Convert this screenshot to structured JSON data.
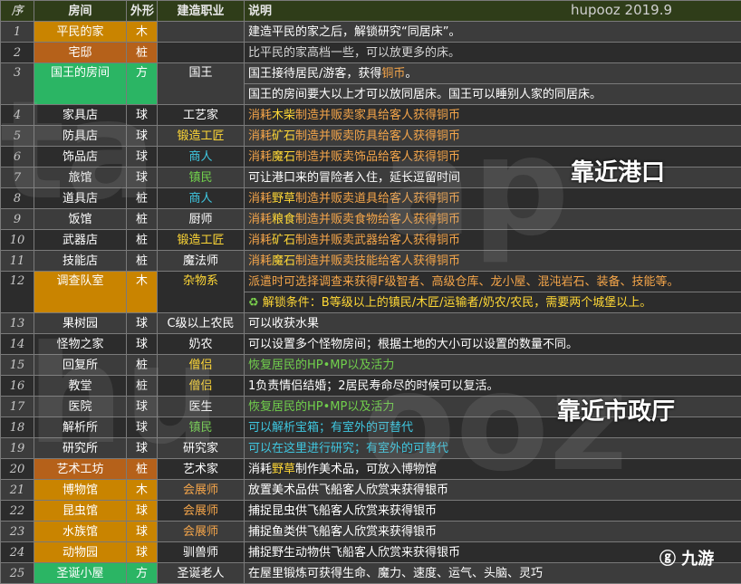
{
  "watermark": "hupooz 2019.9",
  "headers": {
    "idx": "序",
    "name": "房间",
    "shape": "外形",
    "job": "建造职业",
    "desc": "说明"
  },
  "annotations": {
    "port": "靠近港口",
    "cityhall": "靠近市政厅"
  },
  "logo": "九游",
  "rows": [
    {
      "idx": "1",
      "name": "平民的家",
      "shape": "木",
      "job": "",
      "desc": "建造平民的家之后，解锁研究“同居床”。"
    },
    {
      "idx": "2",
      "name": "宅邸",
      "shape": "桩",
      "job": "",
      "desc": "比平民的家高档一些，可以放更多的床。"
    },
    {
      "idx": "3",
      "name": "国王的房间",
      "shape": "方",
      "job": "国王",
      "desc1": "国王接待居民/游客，获得",
      "desc1b": "铜币",
      "desc1c": "。",
      "desc2": "国王的房间要大以上才可以放同居床。国王可以睡别人家的同居床。"
    },
    {
      "idx": "4",
      "name": "家具店",
      "shape": "球",
      "job": "工艺家",
      "d1": "消耗",
      "d2": "木柴",
      "d3": "制造并贩卖家具给客人获得铜币"
    },
    {
      "idx": "5",
      "name": "防具店",
      "shape": "球",
      "job": "锻造工匠",
      "d1": "消耗",
      "d2": "矿石",
      "d3": "制造并贩卖防具给客人获得铜币"
    },
    {
      "idx": "6",
      "name": "饰品店",
      "shape": "球",
      "job": "商人",
      "d1": "消耗",
      "d2": "魔石",
      "d3": "制造并贩卖饰品给客人获得铜币"
    },
    {
      "idx": "7",
      "name": "旅馆",
      "shape": "球",
      "job": "镇民",
      "desc": "可让港口来的冒险者入住，延长逗留时间"
    },
    {
      "idx": "8",
      "name": "道具店",
      "shape": "桩",
      "job": "商人",
      "d1": "消耗",
      "d2": "野草",
      "d3": "制造并贩卖道具给客人获得铜币"
    },
    {
      "idx": "9",
      "name": "饭馆",
      "shape": "桩",
      "job": "厨师",
      "d1": "消耗",
      "d2": "粮食",
      "d3": "制造并贩卖食物给客人获得铜币"
    },
    {
      "idx": "10",
      "name": "武器店",
      "shape": "桩",
      "job": "锻造工匠",
      "d1": "消耗",
      "d2": "矿石",
      "d3": "制造并贩卖武器给客人获得铜币"
    },
    {
      "idx": "11",
      "name": "技能店",
      "shape": "桩",
      "job": "魔法师",
      "d1": "消耗",
      "d2": "魔石",
      "d3": "制造并贩卖技能给客人获得铜币"
    },
    {
      "idx": "12",
      "name": "调查队室",
      "shape": "木",
      "job": "杂物系",
      "desc1": "派遣时可选择调查来获得F级智者、高级仓库、龙小屋、混沌岩石、装备、技能等。",
      "desc2": "解锁条件：B等级以上的镇民/木匠/运输者/奶农/农民，需要两个城堡以上。"
    },
    {
      "idx": "13",
      "name": "果树园",
      "shape": "球",
      "job": "C级以上农民",
      "desc": "可以收获水果"
    },
    {
      "idx": "14",
      "name": "怪物之家",
      "shape": "球",
      "job": "奶农",
      "desc": "可以设置多个怪物房间；根据土地的大小可以设置的数量不同。"
    },
    {
      "idx": "15",
      "name": "回复所",
      "shape": "桩",
      "job": "僧侣",
      "desc": "恢复居民的HP•MP以及活力"
    },
    {
      "idx": "16",
      "name": "教堂",
      "shape": "桩",
      "job": "僧侣",
      "desc": "1负责情侣结婚；2居民寿命尽的时候可以复活。"
    },
    {
      "idx": "17",
      "name": "医院",
      "shape": "球",
      "job": "医生",
      "desc": "恢复居民的HP•MP以及活力"
    },
    {
      "idx": "18",
      "name": "解析所",
      "shape": "球",
      "job": "镇民",
      "desc": "可以解析宝箱；有室外的可替代"
    },
    {
      "idx": "19",
      "name": "研究所",
      "shape": "球",
      "job": "研究家",
      "desc": "可以在这里进行研究；有室外的可替代"
    },
    {
      "idx": "20",
      "name": "艺术工坊",
      "shape": "桩",
      "job": "艺术家",
      "d1": "消耗",
      "d2": "野草",
      "d3": "制作美术品，可放入博物馆"
    },
    {
      "idx": "21",
      "name": "博物馆",
      "shape": "木",
      "job": "会展师",
      "desc": "放置美术品供飞船客人欣赏来获得银币"
    },
    {
      "idx": "22",
      "name": "昆虫馆",
      "shape": "球",
      "job": "会展师",
      "desc": "捕捉昆虫供飞船客人欣赏来获得银币"
    },
    {
      "idx": "23",
      "name": "水族馆",
      "shape": "球",
      "job": "会展师",
      "desc": "捕捉鱼类供飞船客人欣赏来获得银币"
    },
    {
      "idx": "24",
      "name": "动物园",
      "shape": "球",
      "job": "驯兽师",
      "desc": "捕捉野生动物供飞船客人欣赏来获得银币"
    },
    {
      "idx": "25",
      "name": "圣诞小屋",
      "shape": "方",
      "job": "圣诞老人",
      "desc": "在屋里锻炼可获得生命、魔力、速度、运气、头脑、灵巧"
    }
  ]
}
